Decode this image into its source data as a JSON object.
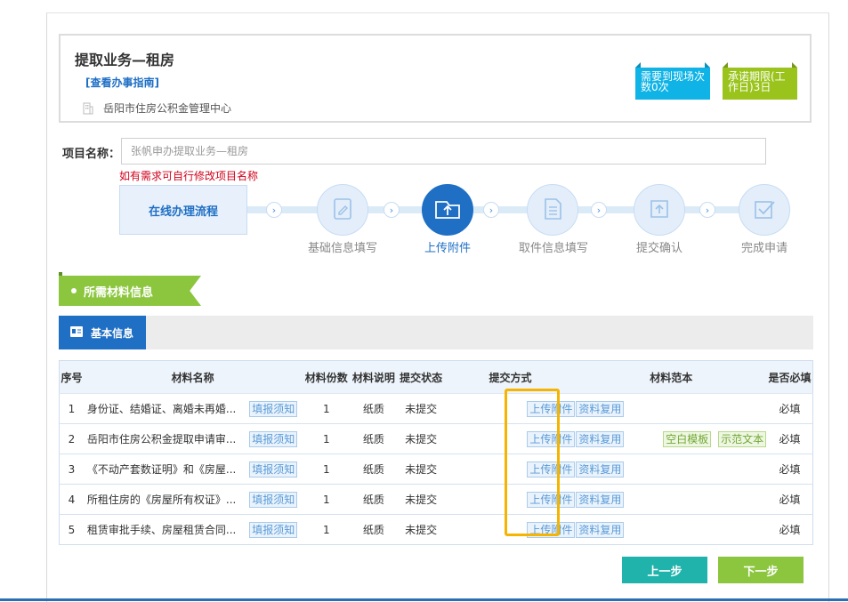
{
  "header": {
    "title": "提取业务—租房",
    "guide_link": "[查看办事指南]",
    "org": "岳阳市住房公积金管理中心",
    "badge_visits": "需要到现场次数0次",
    "badge_deadline": "承诺期限(工作日)3日"
  },
  "project": {
    "label": "项目名称：",
    "placeholder": "张帆申办提取业务—租房",
    "hint": "如有需求可自行修改项目名称"
  },
  "flow": {
    "title": "在线办理流程",
    "steps": [
      {
        "label": "基础信息填写",
        "icon": "edit-icon"
      },
      {
        "label": "上传附件",
        "icon": "upload-folder-icon"
      },
      {
        "label": "取件信息填写",
        "icon": "document-icon"
      },
      {
        "label": "提交确认",
        "icon": "upload-icon"
      },
      {
        "label": "完成申请",
        "icon": "check-icon"
      }
    ],
    "active_step": 1
  },
  "materials": {
    "ribbon": "所需材料信息",
    "tab": "基本信息",
    "columns": [
      "序号",
      "材料名称",
      "材料份数",
      "材料说明",
      "提交状态",
      "提交方式",
      "材料范本",
      "是否必填"
    ],
    "notice_label": "填报须知",
    "upload_label": "上传附件",
    "reuse_label": "资料复用",
    "rows": [
      {
        "no": "1",
        "name": "身份证、结婚证、离婚未再婚...",
        "count": "1",
        "desc": "纸质",
        "status": "未提交",
        "templates": [],
        "required": "必填"
      },
      {
        "no": "2",
        "name": "岳阳市住房公积金提取申请审...",
        "count": "1",
        "desc": "纸质",
        "status": "未提交",
        "templates": [
          "空白模板",
          "示范文本"
        ],
        "required": "必填"
      },
      {
        "no": "3",
        "name": "《不动产套数证明》和《房屋...",
        "count": "1",
        "desc": "纸质",
        "status": "未提交",
        "templates": [],
        "required": "必填"
      },
      {
        "no": "4",
        "name": "所租住房的《房屋所有权证》...",
        "count": "1",
        "desc": "纸质",
        "status": "未提交",
        "templates": [],
        "required": "必填"
      },
      {
        "no": "5",
        "name": "租赁审批手续、房屋租赁合同...",
        "count": "1",
        "desc": "纸质",
        "status": "未提交",
        "templates": [],
        "required": "必填"
      }
    ]
  },
  "buttons": {
    "prev": "上一步",
    "next": "下一步"
  },
  "colors": {
    "primary": "#1f6fc5",
    "green": "#8cc63f",
    "teal": "#1fb3ab",
    "red": "#d0021b",
    "highlight": "#f5b400"
  }
}
